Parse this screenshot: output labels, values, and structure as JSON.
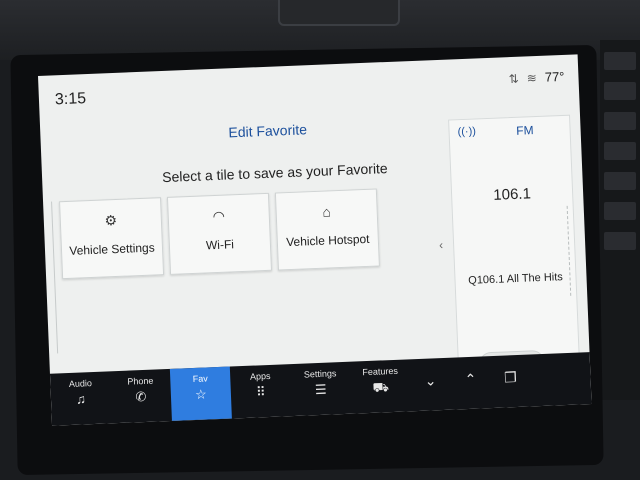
{
  "status": {
    "time": "3:15",
    "temperature": "77°",
    "icons": [
      "signal-arrows-icon",
      "wifi-icon"
    ]
  },
  "edit_favorite": {
    "title": "Edit Favorite",
    "instruction": "Select a tile to save as your Favorite",
    "tiles": [
      {
        "label": "Vehicle Settings",
        "icon": "vehicle-settings-icon"
      },
      {
        "label": "Wi-Fi",
        "icon": "wifi-icon"
      },
      {
        "label": "Vehicle Hotspot",
        "icon": "vehicle-hotspot-icon"
      }
    ]
  },
  "radio": {
    "band": "FM",
    "frequency": "106.1",
    "station": "Q106.1 All The Hits"
  },
  "nav": {
    "items": [
      {
        "label": "Audio",
        "icon": "music-icon"
      },
      {
        "label": "Phone",
        "icon": "phone-icon"
      },
      {
        "label": "Fav",
        "icon": "star-icon",
        "active": true
      },
      {
        "label": "Apps",
        "icon": "apps-grid-icon"
      },
      {
        "label": "Settings",
        "icon": "sliders-icon"
      },
      {
        "label": "Features",
        "icon": "car-icon"
      }
    ]
  },
  "colors": {
    "accent": "#2f7de0",
    "title_blue": "#1b4f9c",
    "screen_bg": "#eef0ef",
    "nav_bg": "#111317"
  }
}
